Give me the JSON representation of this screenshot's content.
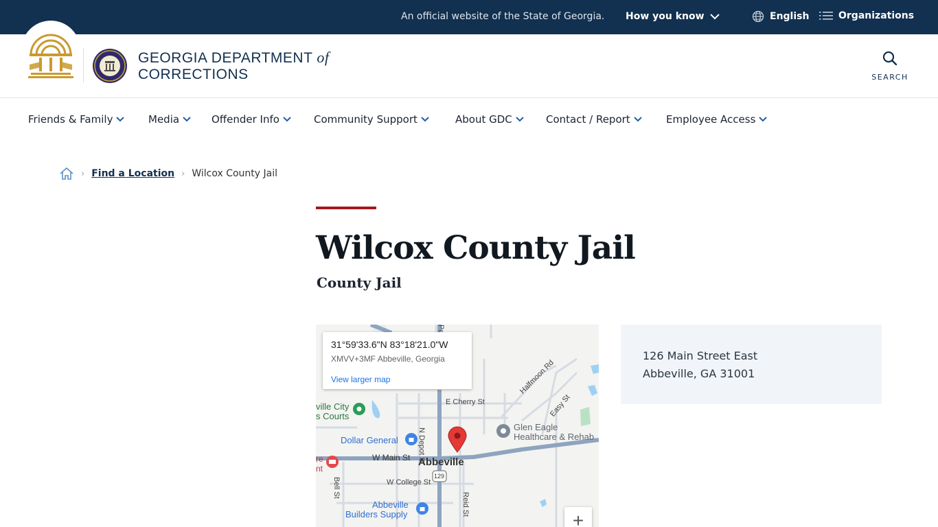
{
  "topbar": {
    "official_text": "An official website of the State of Georgia.",
    "how_you_know": "How you know",
    "language": "English",
    "organizations": "Organizations"
  },
  "header": {
    "agency_line1": "GEORGIA DEPARTMENT",
    "agency_of": "of",
    "agency_line2": "CORRECTIONS",
    "search_label": "SEARCH"
  },
  "nav": {
    "items": [
      {
        "label": "Friends & Family"
      },
      {
        "label": "Media"
      },
      {
        "label": "Offender Info"
      },
      {
        "label": "Community Support"
      },
      {
        "label": "About GDC"
      },
      {
        "label": "Contact / Report"
      },
      {
        "label": "Employee Access"
      }
    ]
  },
  "breadcrumb": {
    "parent": "Find a Location",
    "current": "Wilcox County Jail"
  },
  "page": {
    "title": "Wilcox County Jail",
    "subtitle": "County Jail"
  },
  "map": {
    "coords": "31°59'33.6\"N 83°18'21.0\"W",
    "plus_code": "XMVV+3MF Abbeville, Georgia",
    "larger_map": "View larger map",
    "zoom_in": "+",
    "labels": {
      "e_cherry": "E Cherry St",
      "halfmoon": "Halfmoon Rd",
      "easy": "Easy St",
      "n_depot": "N Depot St",
      "po": "Po",
      "city_courts_1": "ville City",
      "city_courts_2": "s Courts",
      "dollar_general": "Dollar General",
      "glen_eagle_1": "Glen Eagle",
      "glen_eagle_2": "Healthcare & Rehab",
      "w_main": "W Main St",
      "abbeville": "Abbeville",
      "route": "129",
      "w_college": "W College St",
      "bell": "Bell St",
      "reid": "Reid St",
      "builders_1": "Abbeville",
      "builders_2": "Builders Supply",
      "left_edge_1": "re",
      "left_edge_2": "nt"
    }
  },
  "address": {
    "line1": "126 Main Street East",
    "line2": "Abbeville, GA 31001"
  },
  "colors": {
    "navy": "#12304f",
    "accent_red": "#a4171d",
    "address_bg": "#f1f5f9"
  }
}
